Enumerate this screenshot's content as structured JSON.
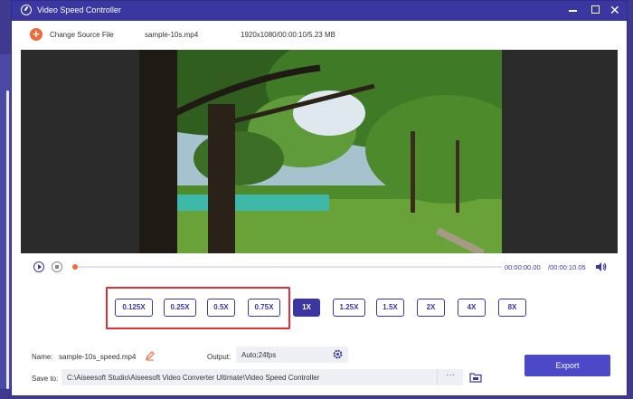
{
  "window": {
    "title": "Video Speed Controller",
    "icon": "speedometer-icon",
    "controls": {
      "minimize": "minimize-icon",
      "maximize": "maximize-icon",
      "close_glyph": "✕"
    }
  },
  "source": {
    "change_label": "Change Source File",
    "file_name": "sample-10s.mp4",
    "file_info": "1920x1080/00:00:10/5.23 MB"
  },
  "playback": {
    "current_time": "00:00:00.00",
    "total_time": "/00:00:10.05",
    "progress": 0,
    "accent": "#ef6a3b"
  },
  "speeds": {
    "options": [
      "0.125X",
      "0.25X",
      "0.5X",
      "0.75X",
      "1X",
      "1.25X",
      "1.5X",
      "2X",
      "4X",
      "8X"
    ],
    "selected": "1X",
    "highlight_color": "#e0303a"
  },
  "output": {
    "name_label": "Name:",
    "name_value": "sample-10s_speed.mp4",
    "output_label": "Output:",
    "output_value": "Auto;24fps",
    "saveto_label": "Save to:",
    "path_value": "C:\\Aiseesoft Studio\\Aiseesoft Video Converter Ultimate\\Video Speed Controller",
    "browse_label": "···",
    "export_label": "Export"
  },
  "colors": {
    "brand": "#3a37a0",
    "export": "#4c49c9"
  }
}
